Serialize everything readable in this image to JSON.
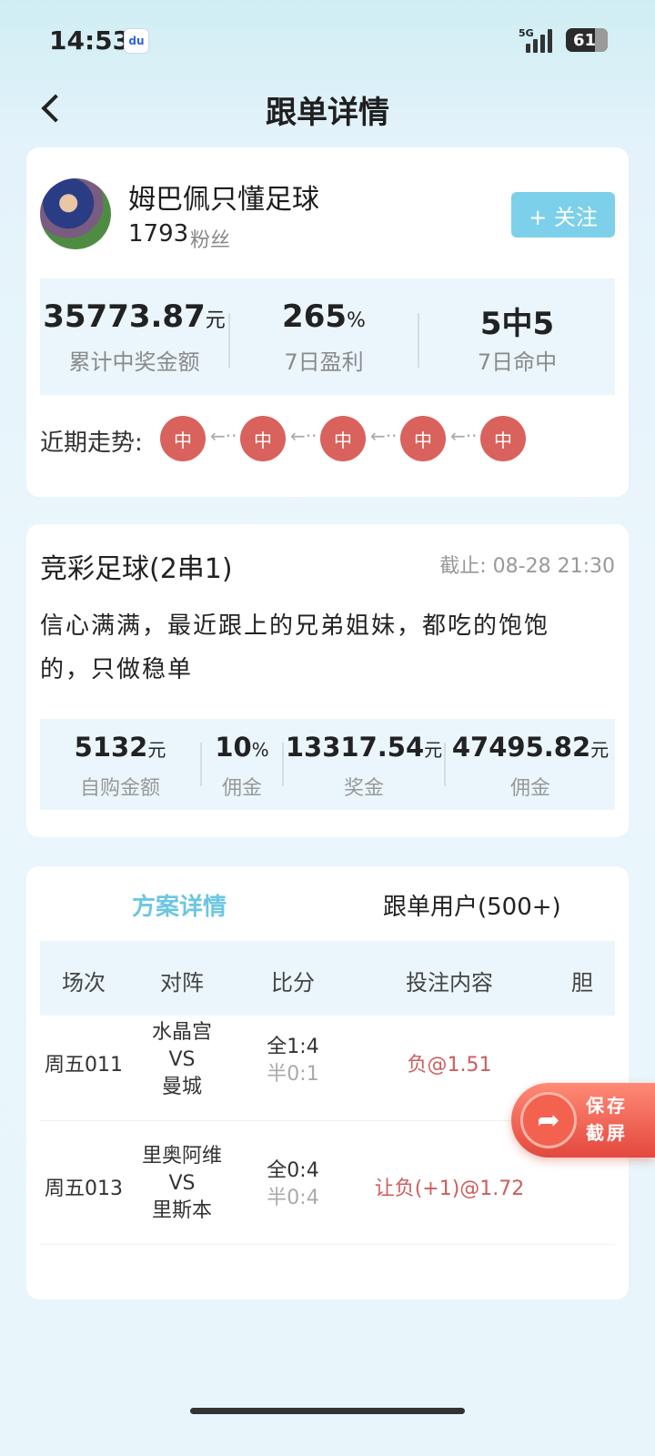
{
  "status_bar": {
    "time": "14:53",
    "network": "5G",
    "battery": "61"
  },
  "nav": {
    "title": "跟单详情"
  },
  "profile": {
    "name": "姆巴佩只懂足球",
    "fans_count": "1793",
    "fans_label": "粉丝",
    "follow_label": "+ 关注"
  },
  "stats": [
    {
      "value": "35773.87",
      "unit": "元",
      "label": "累计中奖金额"
    },
    {
      "value": "265",
      "unit": "%",
      "label": "7日盈利"
    },
    {
      "value": "5中5",
      "unit": "",
      "label": "7日命中"
    }
  ],
  "trend": {
    "label": "近期走势:",
    "items": [
      "中",
      "中",
      "中",
      "中",
      "中"
    ],
    "arrow": "←··"
  },
  "plan": {
    "title": "竞彩足球(2串1)",
    "deadline": "截止: 08-28 21:30",
    "description": "信心满满，最近跟上的兄弟姐妹，都吃的饱饱的，只做稳单",
    "money": [
      {
        "value": "5132",
        "unit": "元",
        "label": "自购金额"
      },
      {
        "value": "10",
        "unit": "%",
        "label": "佣金"
      },
      {
        "value": "13317.54",
        "unit": "元",
        "label": "奖金"
      },
      {
        "value": "47495.82",
        "unit": "元",
        "label": "佣金"
      }
    ]
  },
  "tabs": {
    "active": "方案详情",
    "users": "跟单用户(500+)"
  },
  "table": {
    "headers": [
      "场次",
      "对阵",
      "比分",
      "投注内容",
      "胆"
    ],
    "rows": [
      {
        "match_no": "周五011",
        "home": "水晶宫",
        "vs": "VS",
        "away": "曼城",
        "full": "全1:4",
        "half": "半0:1",
        "bet": "负@1.51"
      },
      {
        "match_no": "周五013",
        "home": "里奥阿维",
        "vs": "VS",
        "away": "里斯本",
        "full": "全0:4",
        "half": "半0:4",
        "bet": "让负(+1)@1.72"
      }
    ]
  },
  "floating": {
    "line1": "保存",
    "line2": "截屏"
  },
  "colors": {
    "accent": "#6cc6e2",
    "follow_bg": "#7cd0ea",
    "hit": "#d9625c",
    "bet_text": "#cf5d5d",
    "panel": "#eaf6fc"
  }
}
